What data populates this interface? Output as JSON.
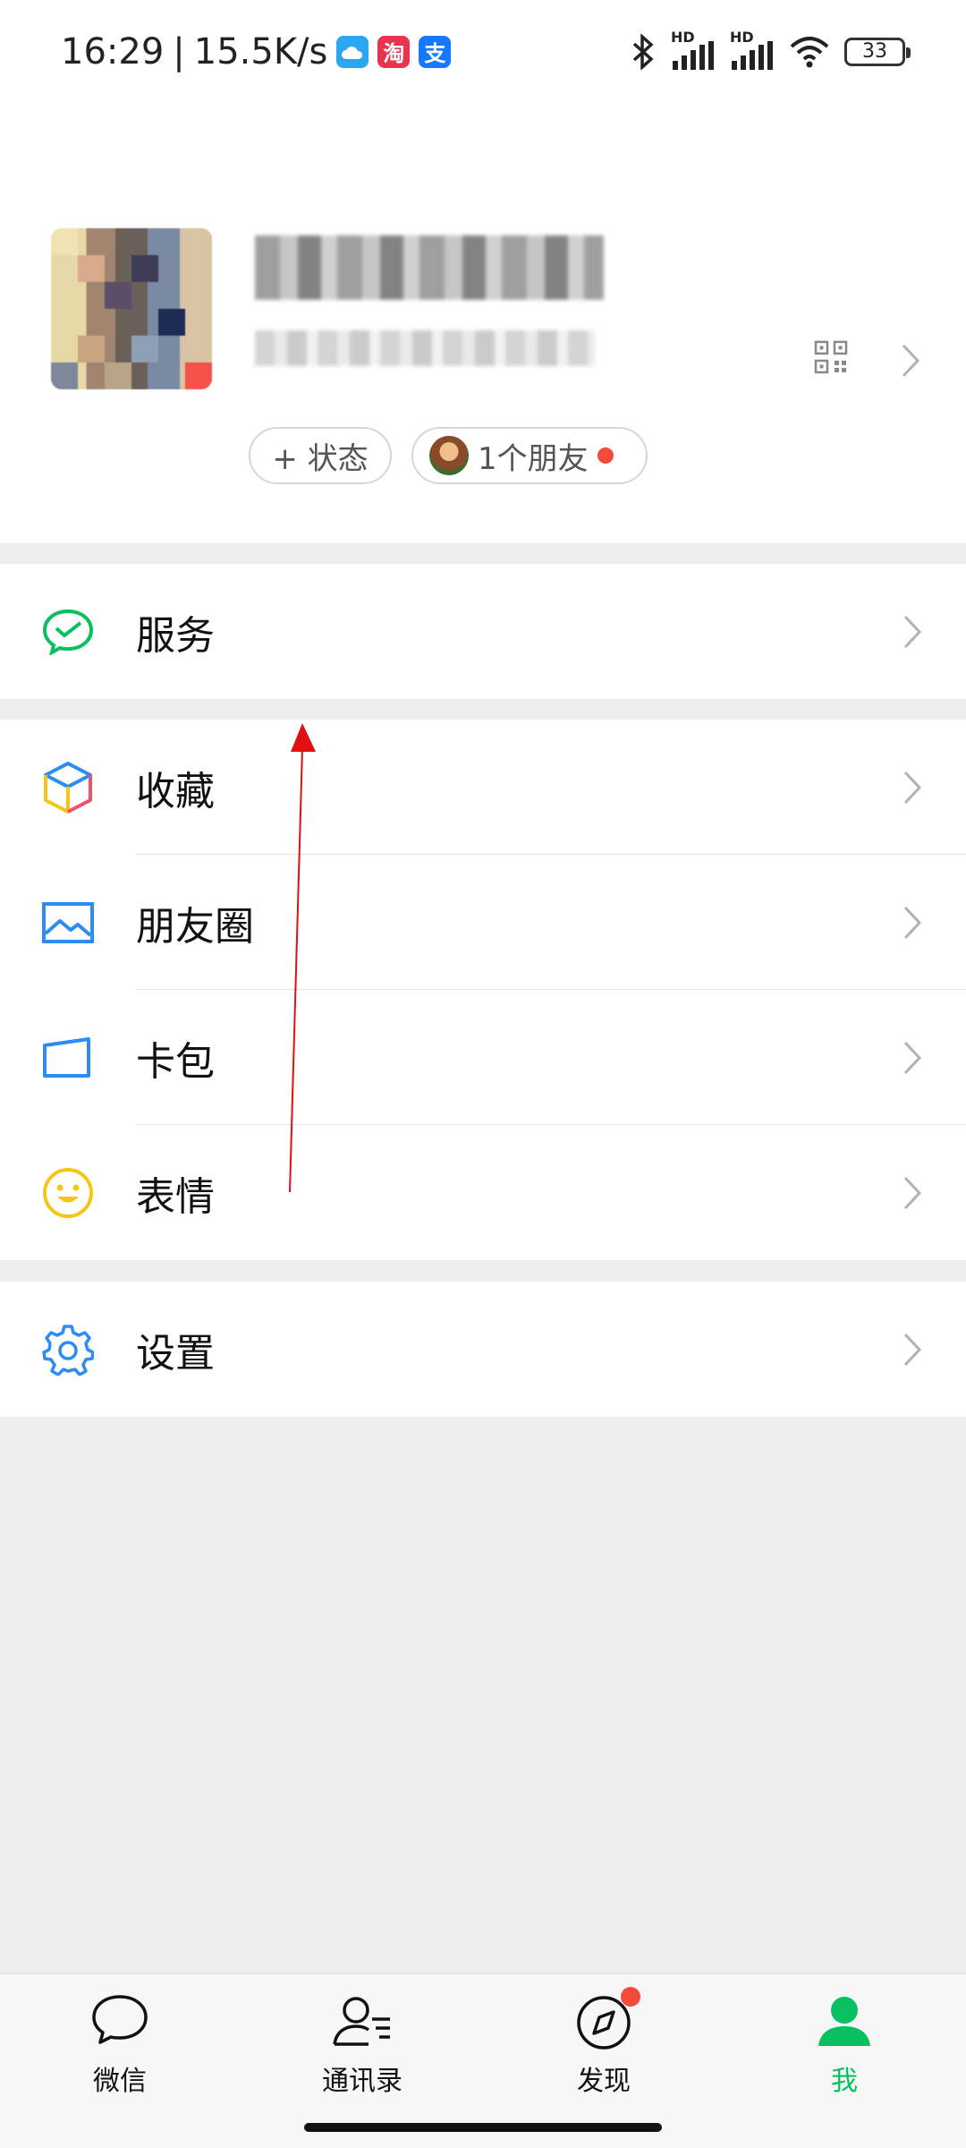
{
  "status_bar": {
    "time": "16:29",
    "separator": "|",
    "network_speed": "15.5K/s",
    "app_icons": [
      "cloud-icon",
      "taobao-icon",
      "alipay-icon"
    ],
    "taobao_glyph": "淘",
    "alipay_glyph": "支",
    "battery_level": "33",
    "signal_label_1": "HD",
    "signal_label_2": "HD"
  },
  "profile": {
    "status_button_label": "+ 状态",
    "friends_button_label": "1个朋友"
  },
  "menu": {
    "group1": [
      {
        "label": "服务",
        "icon": "wechat-pay-service-icon"
      }
    ],
    "group2": [
      {
        "label": "收藏",
        "icon": "favorites-cube-icon"
      },
      {
        "label": "朋友圈",
        "icon": "moments-picture-icon"
      },
      {
        "label": "卡包",
        "icon": "card-wallet-icon"
      },
      {
        "label": "表情",
        "icon": "sticker-smiley-icon"
      }
    ],
    "group3": [
      {
        "label": "设置",
        "icon": "settings-gear-icon"
      }
    ]
  },
  "tab_bar": {
    "tabs": [
      {
        "label": "微信",
        "icon": "chat-bubble-icon"
      },
      {
        "label": "通讯录",
        "icon": "contacts-icon"
      },
      {
        "label": "发现",
        "icon": "compass-icon"
      },
      {
        "label": "我",
        "icon": "me-person-icon"
      }
    ],
    "active_index": 3
  },
  "colors": {
    "accent_green": "#07c160",
    "annotation_red": "#e01010",
    "badge_red": "#f44a3a"
  }
}
